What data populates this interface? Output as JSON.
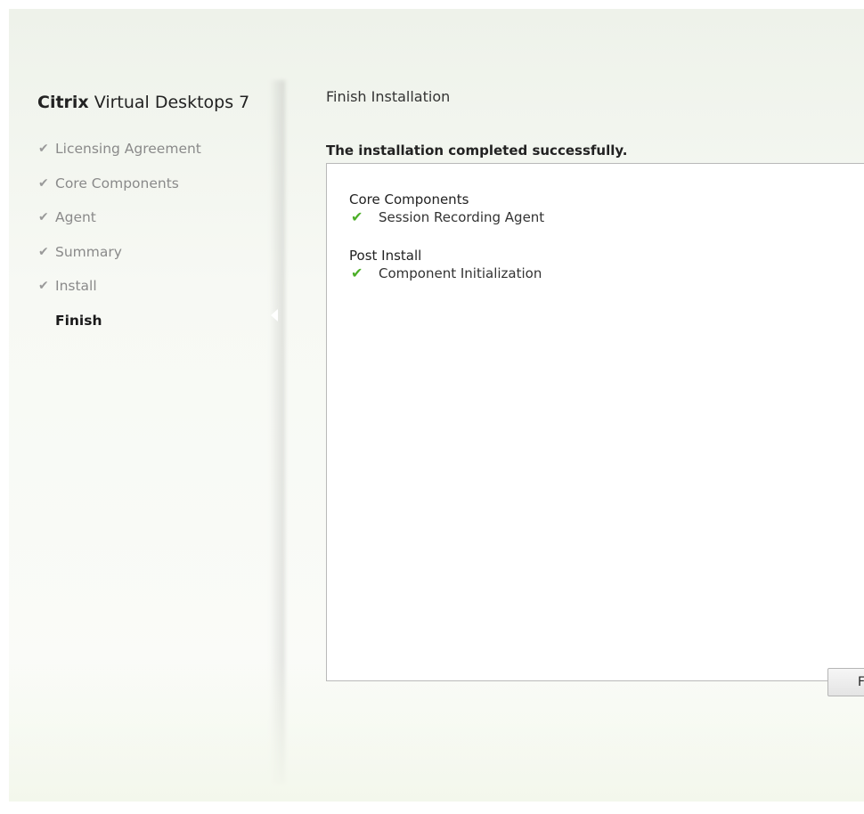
{
  "product": {
    "brand": "Citrix",
    "name": "Virtual Desktops 7"
  },
  "steps": [
    {
      "label": "Licensing Agreement",
      "completed": true
    },
    {
      "label": "Core Components",
      "completed": true
    },
    {
      "label": "Agent",
      "completed": true
    },
    {
      "label": "Summary",
      "completed": true
    },
    {
      "label": "Install",
      "completed": true
    },
    {
      "label": "Finish",
      "completed": false,
      "current": true
    }
  ],
  "page": {
    "title": "Finish Installation",
    "status": "The installation completed successfully."
  },
  "results": [
    {
      "group": "Core Components",
      "items": [
        {
          "label": "Session Recording Agent",
          "icon": "check-icon"
        }
      ]
    },
    {
      "group": "Post Install",
      "items": [
        {
          "label": "Component Initialization",
          "icon": "check-icon"
        }
      ]
    }
  ],
  "buttons": {
    "finish": "Finish"
  },
  "colors": {
    "success": "#4caf28"
  }
}
